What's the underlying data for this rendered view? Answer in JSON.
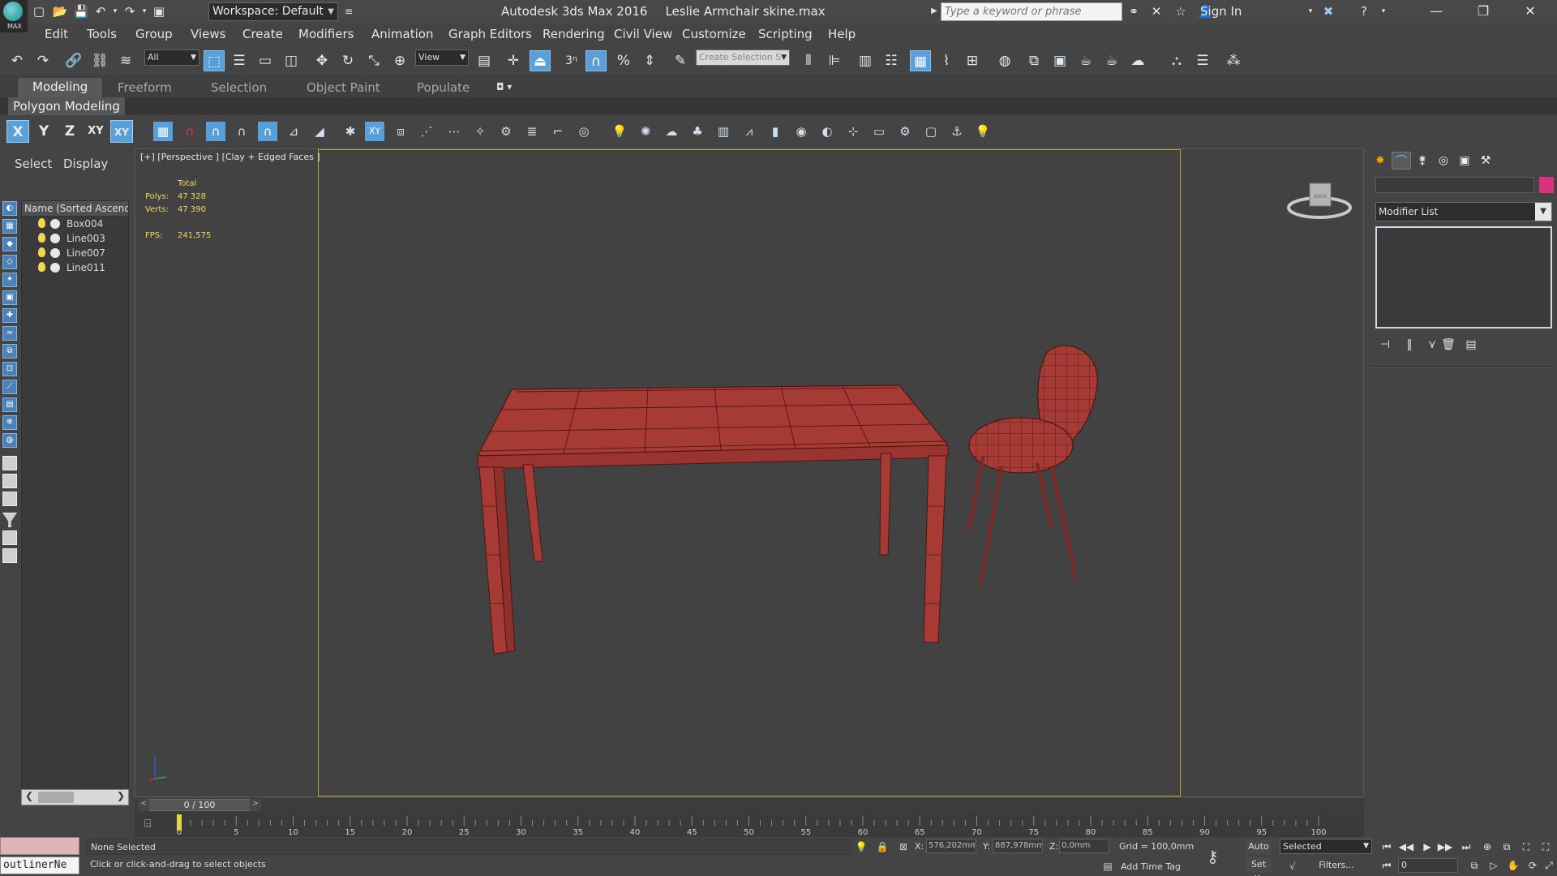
{
  "title_bar": {
    "app_badge": "MAX",
    "workspace_label": "Workspace: Default",
    "app_title": "Autodesk 3ds Max 2016",
    "file_name": "Leslie Armchair skine.max",
    "search_placeholder": "Type a keyword or phrase",
    "sign_in_label": "Sign In"
  },
  "menu": {
    "items": [
      "Edit",
      "Tools",
      "Group",
      "Views",
      "Create",
      "Modifiers",
      "Animation",
      "Graph Editors",
      "Rendering",
      "Civil View",
      "Customize",
      "Scripting",
      "Help"
    ]
  },
  "main_toolbar": {
    "selection_filter": "All",
    "reference_coord": "View",
    "snap_angle_label": "3",
    "create_selection_set_placeholder": "Create Selection S"
  },
  "ribbon": {
    "tabs": [
      "Modeling",
      "Freeform",
      "Selection",
      "Object Paint",
      "Populate"
    ],
    "active_tab": "Modeling",
    "panel_label": "Polygon Modeling"
  },
  "axis_toolbar": {
    "axes": [
      "X",
      "Y",
      "Z",
      "XY",
      "XY"
    ]
  },
  "scene_explorer": {
    "tabs": [
      "Select",
      "Display"
    ],
    "column_header": "Name (Sorted Ascendi",
    "objects": [
      "Box004",
      "Line003",
      "Line007",
      "Line011"
    ]
  },
  "viewport": {
    "label": "[+] [Perspective ] [Clay + Edged Faces ]",
    "stats_total_label": "Total",
    "stats": [
      {
        "key": "Polys:",
        "value": "47 328"
      },
      {
        "key": "Verts:",
        "value": "47 390"
      }
    ],
    "fps_label": "FPS:",
    "fps_value": "241,575",
    "viewcube_text": "BACK",
    "wire_color": "#a63a35",
    "safe_frame_color": "#b9a82b"
  },
  "command_panel": {
    "modifier_list_label": "Modifier List",
    "object_color": "#d8337d"
  },
  "timeline": {
    "frame_readout": "0 / 100",
    "ticks": [
      0,
      5,
      10,
      15,
      20,
      25,
      30,
      35,
      40,
      45,
      50,
      55,
      60,
      65,
      70,
      75,
      80,
      85,
      90,
      95,
      100
    ]
  },
  "status_bar": {
    "maxscript_text": "outlinerNe",
    "selection_info": "None Selected",
    "prompt": "Click or click-and-drag to select objects",
    "x_label": "X:",
    "x_value": "576,202mm",
    "y_label": "Y:",
    "y_value": "887,978mm",
    "z_label": "Z:",
    "z_value": "0,0mm",
    "grid": "Grid = 100,0mm",
    "add_time_tag": "Add Time Tag",
    "auto_key": "Auto",
    "set_key": "Set K.",
    "key_filter": "Selected",
    "filters": "Filters...",
    "current_frame": "0"
  }
}
